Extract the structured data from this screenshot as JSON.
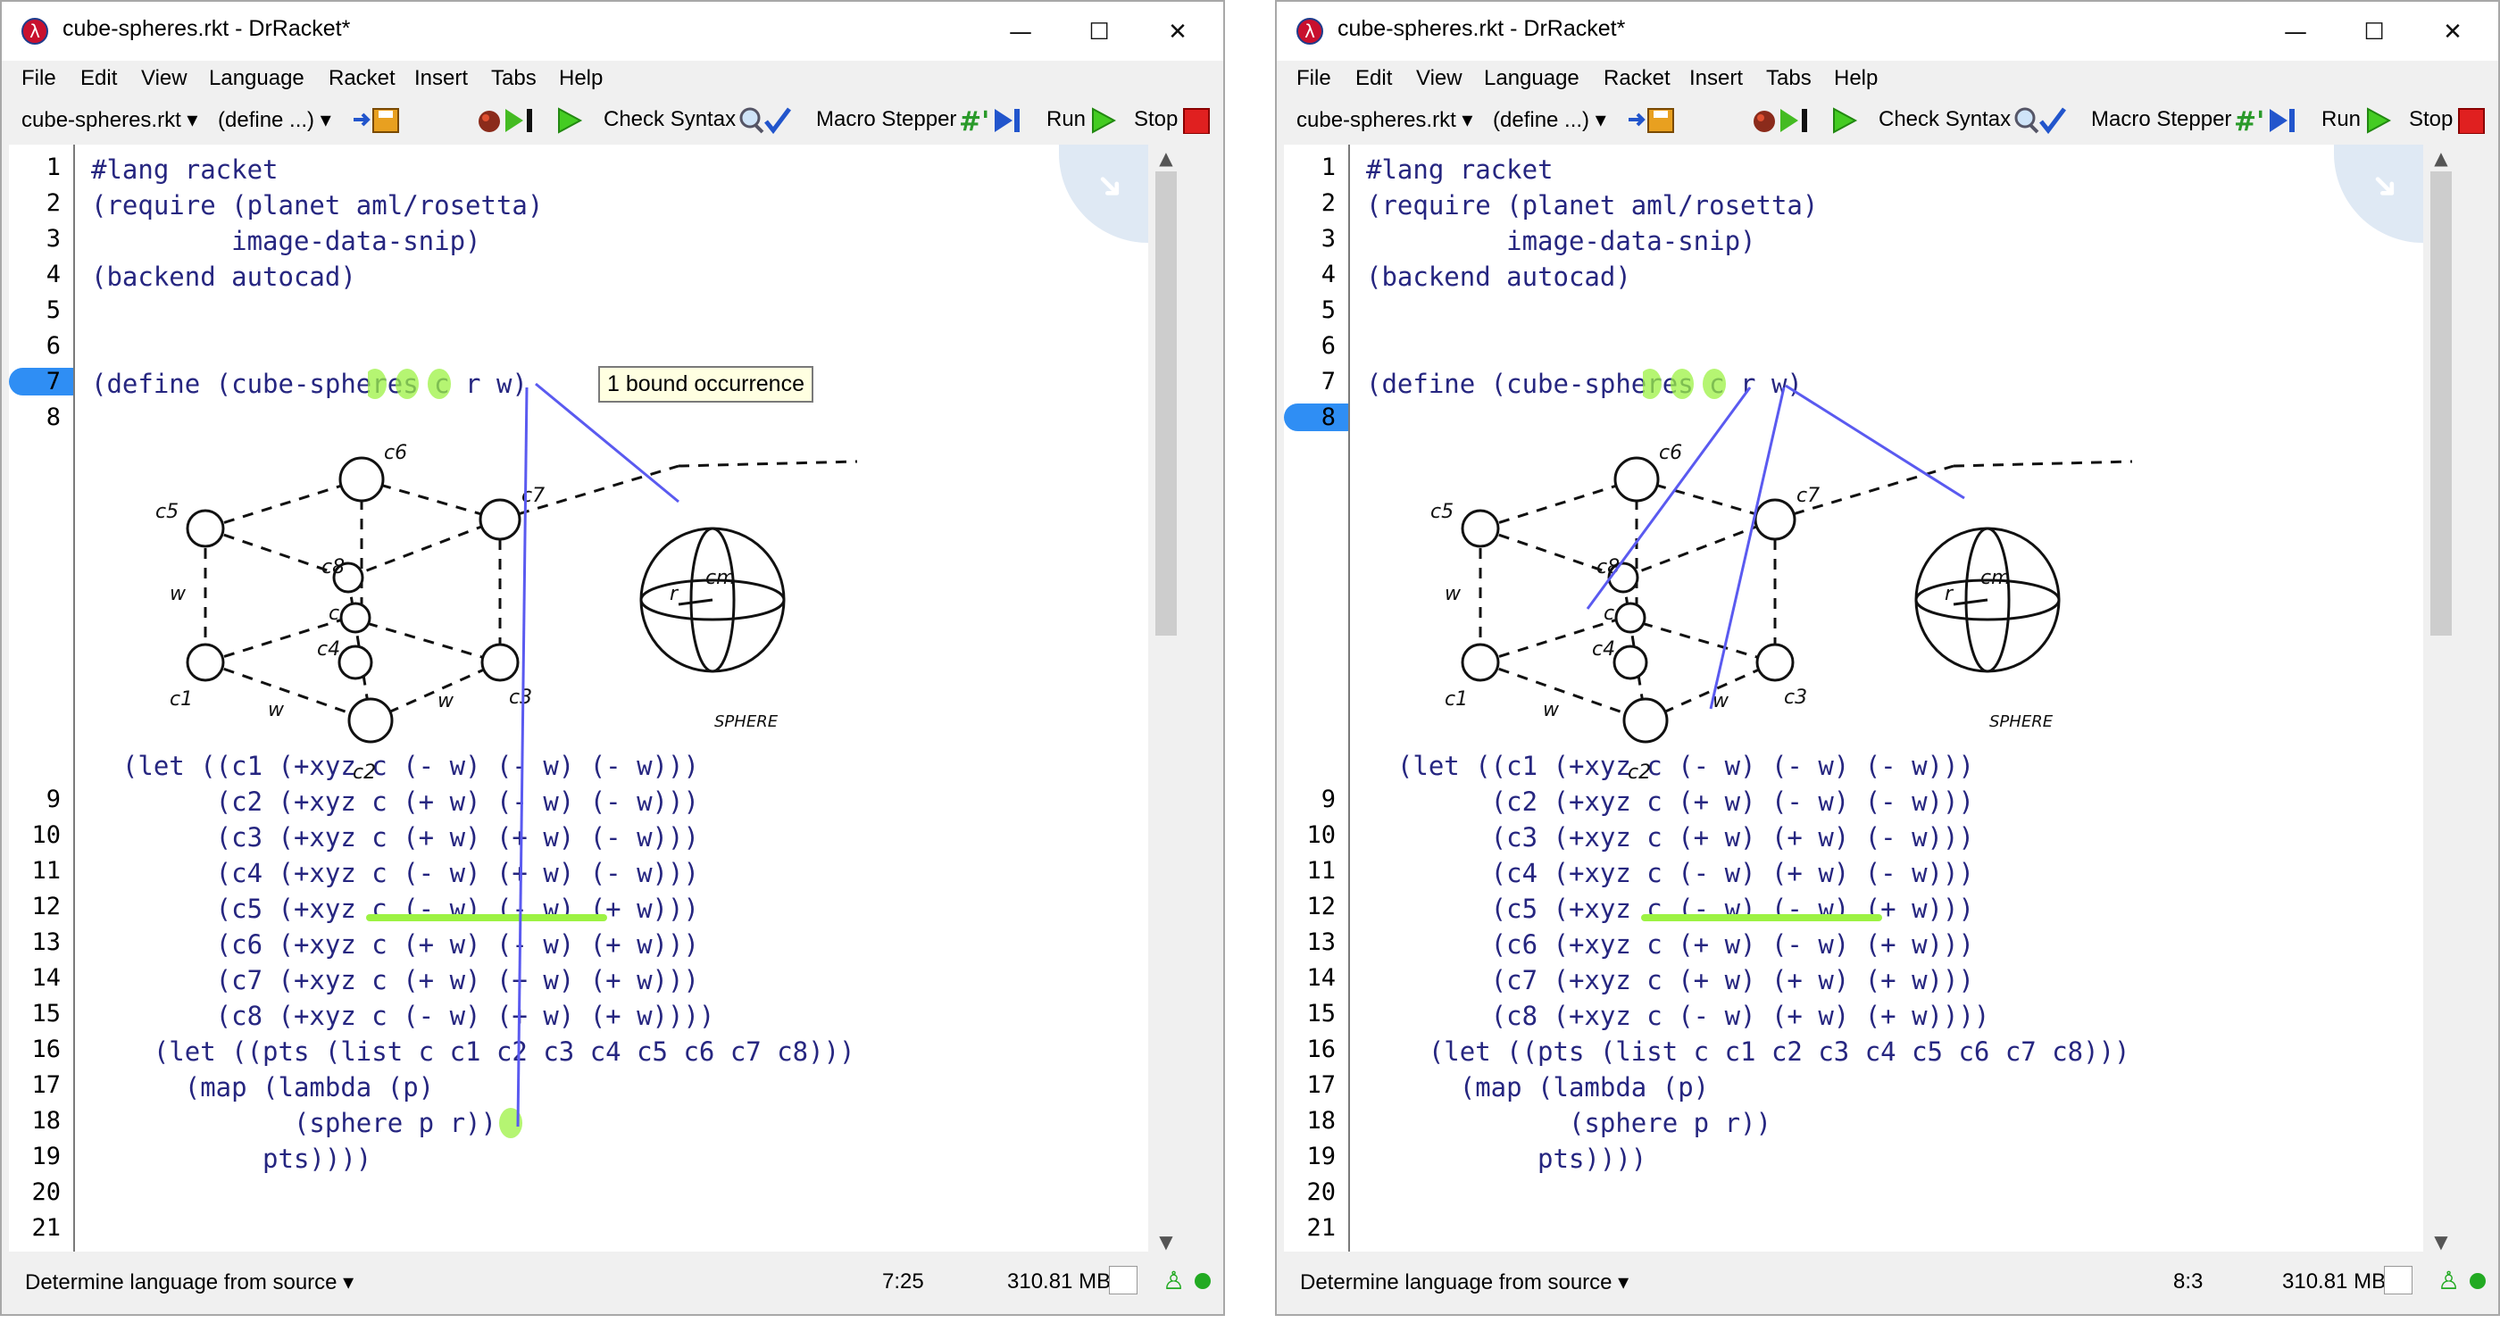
{
  "windows": [
    {
      "id": "left",
      "title": "cube-spheres.rkt - DrRacket*",
      "menu": [
        "File",
        "Edit",
        "View",
        "Language",
        "Racket",
        "Insert",
        "Tabs",
        "Help"
      ],
      "toolbar": {
        "file_selector": "cube-spheres.rkt ▾",
        "define_selector": "(define ...) ▾",
        "check_syntax": "Check Syntax",
        "macro_stepper": "Macro Stepper",
        "run": "Run",
        "stop": "Stop"
      },
      "current_line": 7,
      "tooltip": "1 bound occurrence",
      "status": {
        "language": "Determine language from source ▾",
        "position": "7:25",
        "memory": "310.81 MB"
      }
    },
    {
      "id": "right",
      "title": "cube-spheres.rkt - DrRacket*",
      "menu": [
        "File",
        "Edit",
        "View",
        "Language",
        "Racket",
        "Insert",
        "Tabs",
        "Help"
      ],
      "toolbar": {
        "file_selector": "cube-spheres.rkt ▾",
        "define_selector": "(define ...) ▾",
        "check_syntax": "Check Syntax",
        "macro_stepper": "Macro Stepper",
        "run": "Run",
        "stop": "Stop"
      },
      "current_line": 8,
      "tooltip": "",
      "status": {
        "language": "Determine language from source ▾",
        "position": "8:3",
        "memory": "310.81 MB"
      }
    }
  ],
  "line_numbers": [
    "1",
    "2",
    "3",
    "4",
    "5",
    "6",
    "7",
    "8",
    "9",
    "10",
    "11",
    "12",
    "13",
    "14",
    "15",
    "16",
    "17",
    "18",
    "19",
    "20",
    "21"
  ],
  "code": {
    "l1": "#lang racket",
    "l2": "(require (planet aml/rosetta)",
    "l3": "         image-data-snip)",
    "l4": "(backend autocad)",
    "l7": "(define (cube-spheres c r w)",
    "l9": "  (let ((c1 (+xyz c (- w) (- w) (- w)))",
    "l10": "        (c2 (+xyz c (+ w) (- w) (- w)))",
    "l11": "        (c3 (+xyz c (+ w) (+ w) (- w)))",
    "l12": "        (c4 (+xyz c (- w) (+ w) (- w)))",
    "l13": "        (c5 (+xyz c (- w) (- w) (+ w)))",
    "l14": "        (c6 (+xyz c (+ w) (- w) (+ w)))",
    "l15": "        (c7 (+xyz c (+ w) (+ w) (+ w)))",
    "l16": "        (c8 (+xyz c (- w) (+ w) (+ w))))",
    "l17": "    (let ((pts (list c c1 c2 c3 c4 c5 c6 c7 c8)))",
    "l18": "      (map (lambda (p)",
    "l19": "             (sphere p r))",
    "l20": "           pts))))"
  },
  "sketch_labels": {
    "c1": "c1",
    "c2": "c2",
    "c3": "c3",
    "c4": "c4",
    "c5": "c5",
    "c6": "c6",
    "c7": "c7",
    "c8": "c8",
    "c": "c",
    "w": "w",
    "cm": "cm",
    "r": "r",
    "sphere": "SPHERE"
  }
}
